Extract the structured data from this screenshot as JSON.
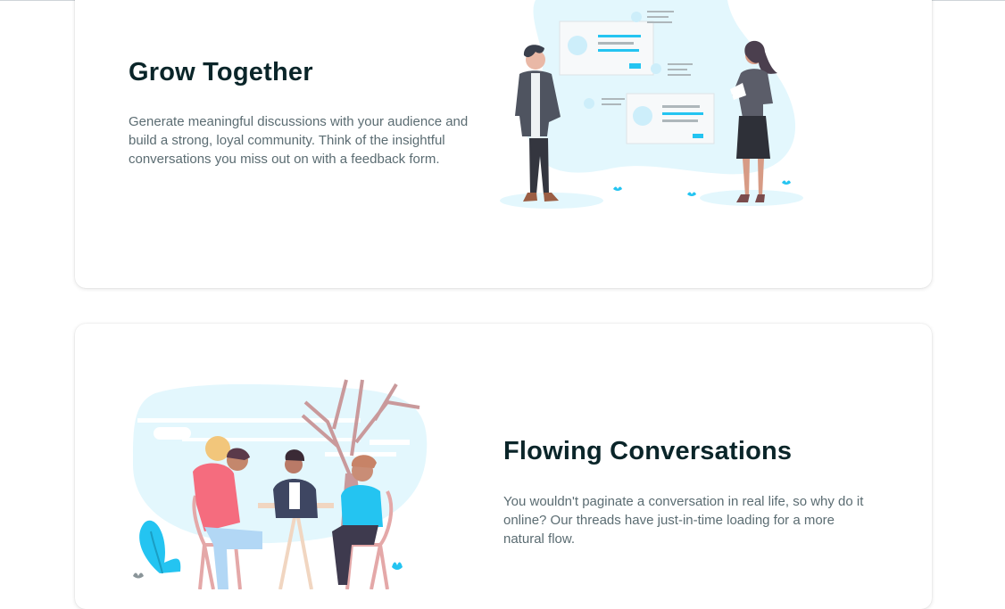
{
  "sections": [
    {
      "title": "Grow Together",
      "description": "Generate meaningful discussions with your audience and build a strong, loyal community. Think of the insightful conversations you miss out on with a feedback form.",
      "illustration": "people-chatting-illustration"
    },
    {
      "title": "Flowing Conversations",
      "description": "You wouldn't paginate a conversation in real life, so why do it online? Our threads have just-in-time loading for a more natural flow.",
      "illustration": "people-at-table-illustration"
    }
  ],
  "colors": {
    "heading": "#0a2529",
    "body_text": "#5b6c72",
    "accent": "#24c4f1",
    "blob": "#e3f7fd"
  }
}
